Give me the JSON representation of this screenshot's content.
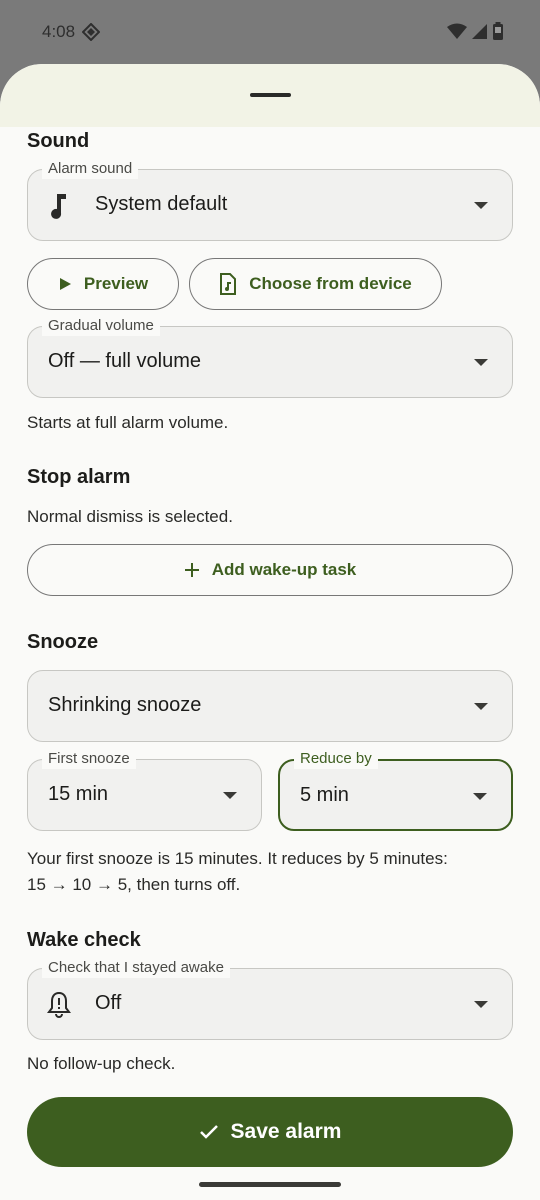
{
  "status_bar": {
    "time": "4:08"
  },
  "sound": {
    "title": "Sound",
    "alarm_sound": {
      "label": "Alarm sound",
      "value": "System default",
      "icon": "music-note-icon"
    },
    "preview_label": "Preview",
    "choose_label": "Choose from device",
    "gradual_volume": {
      "label": "Gradual volume",
      "value": "Off — full volume"
    },
    "helper": "Starts at full alarm volume."
  },
  "stop_alarm": {
    "title": "Stop alarm",
    "helper": "Normal dismiss is selected.",
    "add_task_label": "Add wake-up task"
  },
  "snooze": {
    "title": "Snooze",
    "mode": {
      "value": "Shrinking snooze"
    },
    "first_snooze": {
      "label": "First snooze",
      "value": "15 min"
    },
    "reduce_by": {
      "label": "Reduce by",
      "value": "5 min"
    },
    "helper_line1": "Your first snooze is 15 minutes. It reduces by 5 minutes:",
    "helper_line2": "15 → 10 → 5, then turns off."
  },
  "wake_check": {
    "title": "Wake check",
    "field": {
      "label": "Check that I stayed awake",
      "value": "Off",
      "icon": "bell-alert-icon"
    },
    "helper": "No follow-up check."
  },
  "save_label": "Save alarm",
  "colors": {
    "accent": "#3d5e1f",
    "sheet_header": "#f2f3e6",
    "field_bg": "#f1f1ef"
  }
}
